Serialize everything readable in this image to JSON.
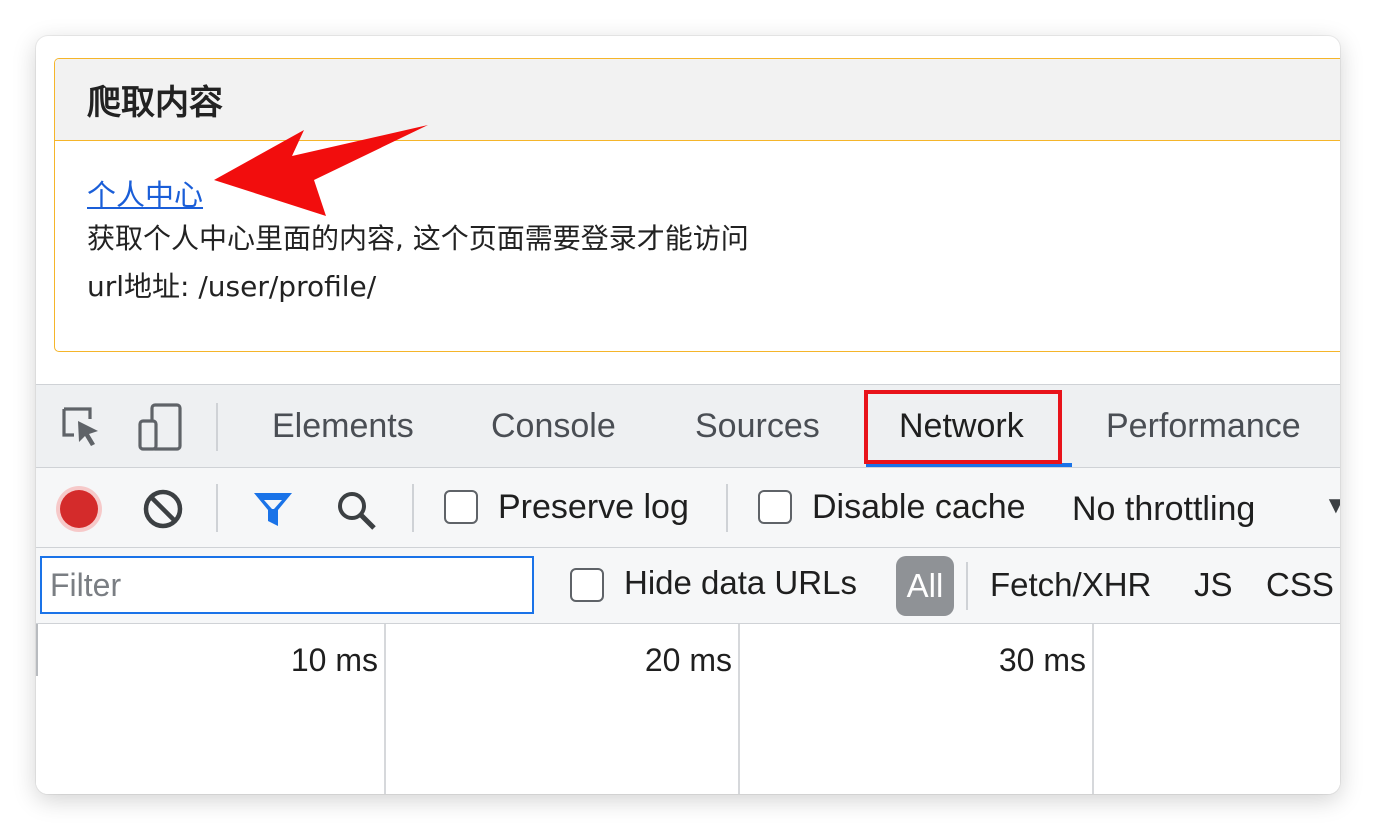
{
  "page": {
    "card_title": "爬取内容",
    "link_text": "个人中心",
    "description": "获取个人中心里面的内容, 这个页面需要登录才能访问",
    "url_line": "url地址: /user/profile/"
  },
  "devtools": {
    "tabs": [
      "Elements",
      "Console",
      "Sources",
      "Network",
      "Performance"
    ],
    "active_tab": "Network",
    "toolbar": {
      "preserve_log": "Preserve log",
      "disable_cache": "Disable cache",
      "throttling": "No throttling",
      "dropdown_glyph": "▼"
    },
    "filter": {
      "placeholder": "Filter",
      "hide_data_urls": "Hide data URLs",
      "all": "All",
      "types": [
        "Fetch/XHR",
        "JS",
        "CSS"
      ]
    },
    "timeline": {
      "ticks": [
        "10 ms",
        "20 ms",
        "30 ms"
      ]
    }
  },
  "colors": {
    "card_border": "#f5b52a",
    "link": "#1a5ed8",
    "annotation_red": "#e8131b",
    "active_tab_underline": "#1a73e8",
    "record": "#d42b2b"
  }
}
